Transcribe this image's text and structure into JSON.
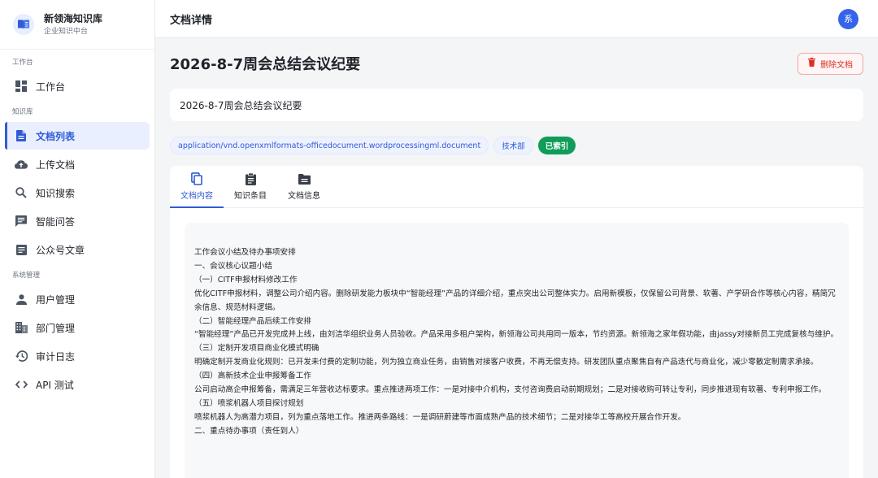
{
  "brand": {
    "title": "新领海知识库",
    "subtitle": "企业知识中台",
    "icon": "book-icon",
    "accent": "#2f5bd6"
  },
  "sidebar": {
    "sections": [
      {
        "label": "工作台",
        "items": [
          {
            "label": "工作台",
            "icon": "dashboard-icon"
          }
        ]
      },
      {
        "label": "知识库",
        "items": [
          {
            "label": "文档列表",
            "icon": "document-icon",
            "active": true
          },
          {
            "label": "上传文档",
            "icon": "cloud-upload-icon"
          },
          {
            "label": "知识搜索",
            "icon": "search-icon"
          },
          {
            "label": "智能问答",
            "icon": "chat-icon"
          },
          {
            "label": "公众号文章",
            "icon": "article-icon"
          }
        ]
      },
      {
        "label": "系统管理",
        "items": [
          {
            "label": "用户管理",
            "icon": "user-icon"
          },
          {
            "label": "部门管理",
            "icon": "building-icon"
          },
          {
            "label": "审计日志",
            "icon": "history-icon"
          },
          {
            "label": "API 测试",
            "icon": "code-icon"
          }
        ]
      }
    ]
  },
  "header": {
    "title": "文档详情",
    "avatar_text": "系"
  },
  "document": {
    "title": "2026-8-7周会总结会议纪要",
    "name_value": "2026-8-7周会总结会议纪要",
    "delete_label": "删除文档",
    "tags": [
      {
        "label": "application/vnd.openxmlformats-officedocument.wordprocessingml.document",
        "style": "blue"
      },
      {
        "label": "技术部",
        "style": "blue"
      },
      {
        "label": "已索引",
        "style": "green"
      }
    ]
  },
  "tabs": [
    {
      "label": "文档内容",
      "icon": "copy-icon",
      "active": true
    },
    {
      "label": "知识条目",
      "icon": "clipboard-icon"
    },
    {
      "label": "文档信息",
      "icon": "folder-icon"
    }
  ],
  "content_lines": [
    "工作会议小结及待办事项安排",
    "一、会议核心议题小结",
    "（一）CITF申报材料修改工作",
    "优化CITF申报材料，调整公司介绍内容。删除研发能力板块中“智能经理”产品的详细介绍，重点突出公司整体实力。启用新模板，仅保留公司背景、软著、产学研合作等核心内容，精简冗余信息、规范材料逻辑。",
    "（二）智能经理产品后续工作安排",
    "“智能经理”产品已开发完成并上线，由刘洁华组织业务人员验收。产品采用多租户架构，新领海公司共用同一版本，节约资源。新领海之家年假功能，由jassy对接新员工完成复核与维护。",
    "（三）定制开发项目商业化模式明确",
    "明确定制开发商业化规则：已开发未付费的定制功能，列为独立商业任务，由销售对接客户收费，不再无偿支持。研发团队重点聚焦自有产品迭代与商业化，减少零散定制需求承接。",
    "（四）高新技术企业申报筹备工作",
    "公司启动高企申报筹备，需满足三年营收达标要求。重点推进两项工作：一是对接中介机构，支付咨询费启动前期规划；二是对接收购可转让专利，同步推进现有软著、专利申报工作。",
    "（五）喷浆机器人项目探讨规划",
    "喷浆机器人为高潜力项目，列为重点落地工作。推进两条路线：一是调研蔚建等市面成熟产品的技术细节；二是对接华工等高校开展合作开发。",
    "二、重点待办事项（责任到人）"
  ]
}
